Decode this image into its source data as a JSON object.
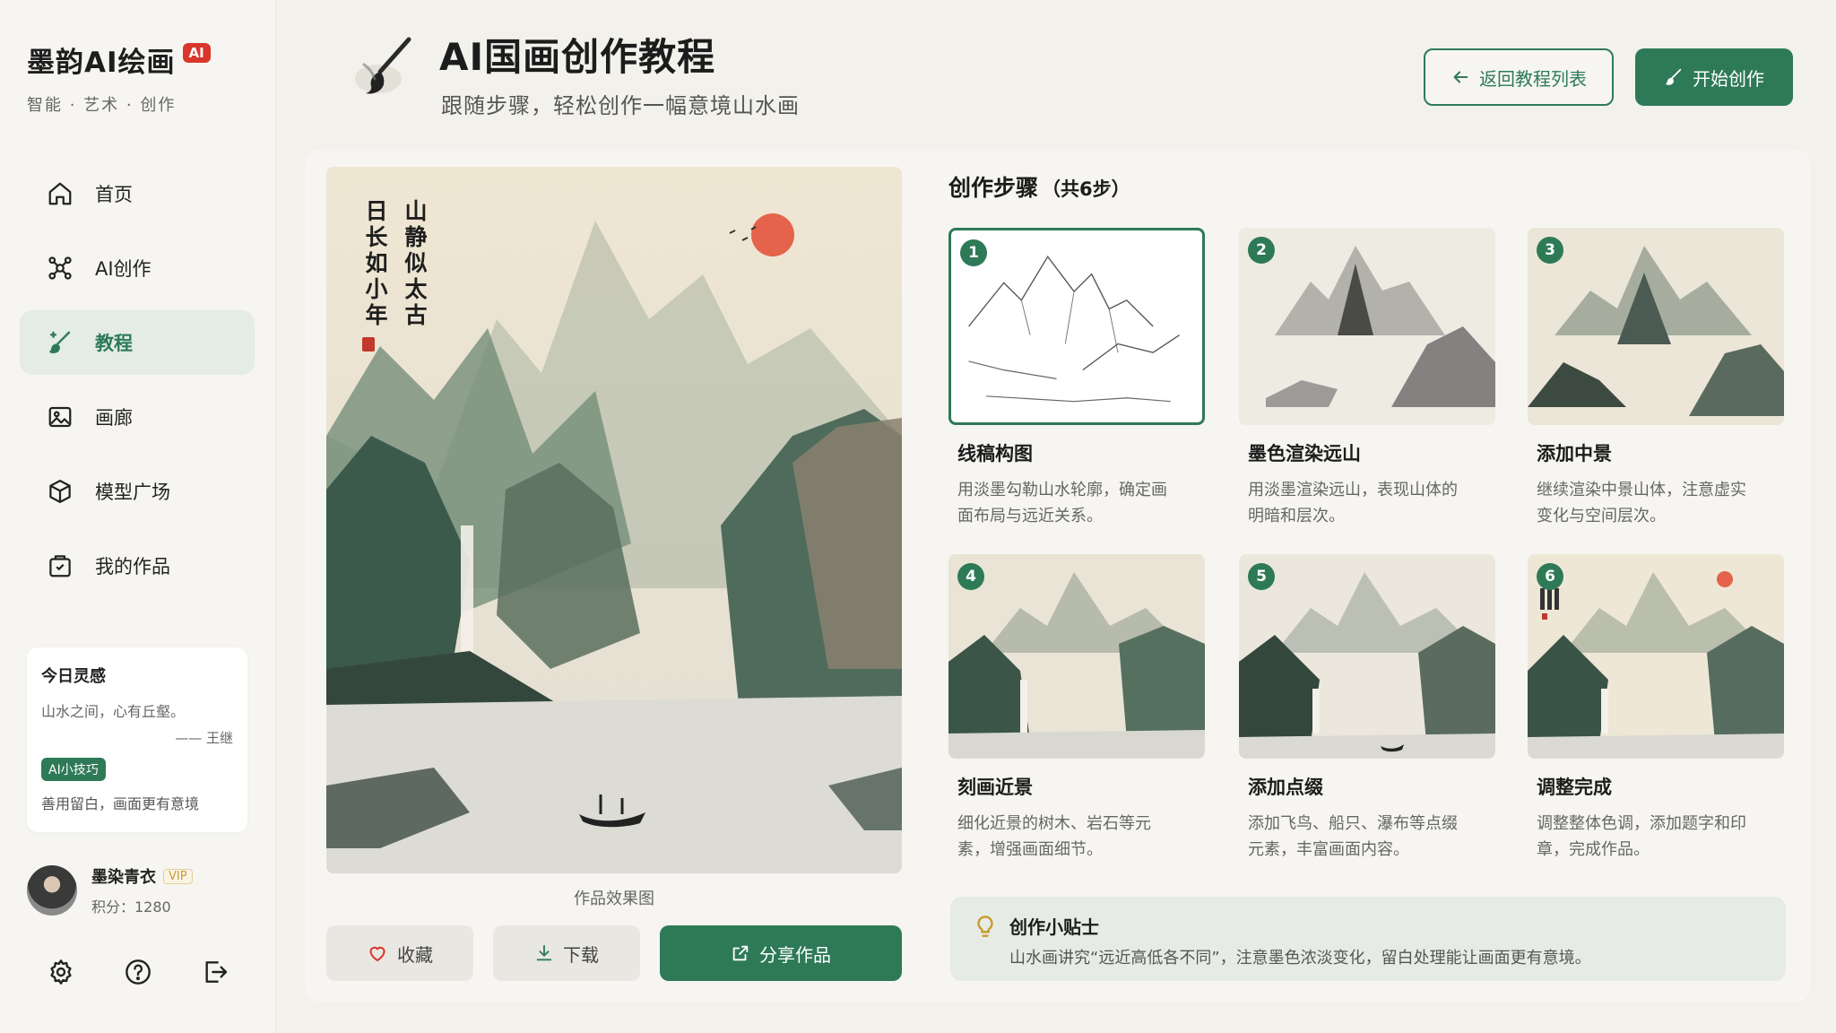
{
  "brand": {
    "title": "墨韵AI绘画",
    "badge": "AI",
    "subtitle": "智能 · 艺术 · 创作"
  },
  "nav": [
    {
      "label": "首页",
      "icon": "home-icon",
      "active": false
    },
    {
      "label": "AI创作",
      "icon": "ai-create-icon",
      "active": false
    },
    {
      "label": "教程",
      "icon": "brush-icon",
      "active": true
    },
    {
      "label": "画廊",
      "icon": "image-icon",
      "active": false
    },
    {
      "label": "模型广场",
      "icon": "cube-icon",
      "active": false
    },
    {
      "label": "我的作品",
      "icon": "portfolio-icon",
      "active": false
    }
  ],
  "inspiration": {
    "title": "今日灵感",
    "quote": "山水之间，心有丘壑。",
    "author": "—— 王继",
    "tip_badge": "AI小技巧",
    "tip": "善用留白，画面更有意境"
  },
  "user": {
    "name": "墨染青衣",
    "vip": "VIP",
    "points": "积分：1280"
  },
  "header": {
    "title": "AI国画创作教程",
    "subtitle": "跟随步骤，轻松创作一幅意境山水画",
    "back_label": "返回教程列表",
    "start_label": "开始创作"
  },
  "painting": {
    "poem": [
      "山静似太古",
      "日长如小年"
    ],
    "caption": "作品效果图"
  },
  "actions": {
    "favorite": "收藏",
    "download": "下载",
    "share": "分享作品"
  },
  "steps_section": {
    "title": "创作步骤",
    "count": "（共6步）"
  },
  "steps": [
    {
      "num": "1",
      "title": "线稿构图",
      "desc": "用淡墨勾勒山水轮廓，确定画面布局与远近关系。"
    },
    {
      "num": "2",
      "title": "墨色渲染远山",
      "desc": "用淡墨渲染远山，表现山体的明暗和层次。"
    },
    {
      "num": "3",
      "title": "添加中景",
      "desc": "继续渲染中景山体，注意虚实变化与空间层次。"
    },
    {
      "num": "4",
      "title": "刻画近景",
      "desc": "细化近景的树木、岩石等元素，增强画面细节。"
    },
    {
      "num": "5",
      "title": "添加点缀",
      "desc": "添加飞鸟、船只、瀑布等点缀元素，丰富画面内容。"
    },
    {
      "num": "6",
      "title": "调整完成",
      "desc": "调整整体色调，添加题字和印章，完成作品。"
    }
  ],
  "tips": {
    "title": "创作小贴士",
    "text": "山水画讲究“远近高低各不同”，注意墨色浓淡变化，留白处理能让画面更有意境。"
  },
  "colors": {
    "accent": "#2e7a57",
    "badge_red": "#d9362c",
    "background": "#f2f1ec"
  }
}
